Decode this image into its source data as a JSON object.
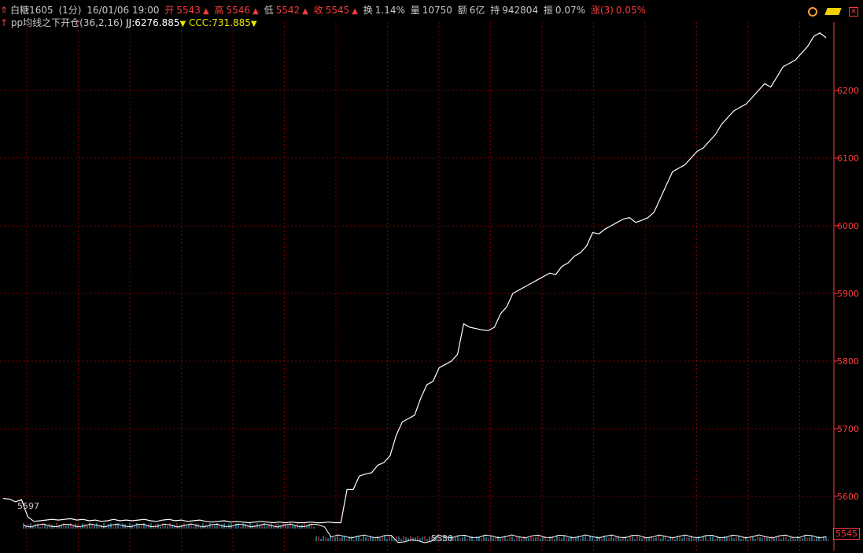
{
  "header": {
    "symbol": "白糖1605",
    "period": "(1分)",
    "datetime": "16/01/06 19:00",
    "open_label": "开",
    "open_value": "5543",
    "high_label": "高",
    "high_value": "5546",
    "low_label": "低",
    "low_value": "5542",
    "close_label": "收",
    "close_value": "5545",
    "turnover_label": "换",
    "turnover_value": "1.14%",
    "volume_label": "量",
    "volume_value": "10750",
    "amount_label": "额",
    "amount_value": "6亿",
    "oi_label": "持",
    "oi_value": "942804",
    "amplitude_label": "振",
    "amplitude_value": "0.07%",
    "change_label": "涨(3)",
    "change_value": "0.05%"
  },
  "indicator": {
    "name": "pp均线之下开仓(36,2,16)",
    "jj_label": "JJ:",
    "jj_value": "6276.885",
    "ccc_label": "CCC:",
    "ccc_value": "731.885"
  },
  "icons": {
    "left_marker": "up-arrow-icon",
    "clock": "clock-icon",
    "gold": "gold-bar-icon",
    "close": "close-icon"
  },
  "colors": {
    "background": "#000000",
    "grid": "#8b0000",
    "axis": "#ff3b3b",
    "line": "#ffffff",
    "up": "#ff3b3b",
    "down": "#00d800"
  },
  "chart_data": {
    "type": "line",
    "y_ticks": [
      5600,
      5700,
      5800,
      5900,
      6000,
      6100,
      6200
    ],
    "ylim": [
      5530,
      6285
    ],
    "annotations": [
      {
        "text": "5597",
        "value": 5597
      },
      {
        "text": "5530",
        "value": 5530
      }
    ],
    "last_price": "5545",
    "series": [
      {
        "values": [
          5597,
          5596,
          5592,
          5595,
          5570,
          5563,
          5564,
          5565,
          5566,
          5565,
          5566,
          5567,
          5565,
          5566,
          5564,
          5565,
          5563,
          5564,
          5566,
          5564,
          5565,
          5564,
          5565,
          5566,
          5564,
          5563,
          5565,
          5566,
          5564,
          5565,
          5563,
          5564,
          5565,
          5563,
          5562,
          5563,
          5564,
          5562,
          5563,
          5562,
          5561,
          5562,
          5563,
          5562,
          5561,
          5562,
          5561,
          5562,
          5561,
          5561,
          5562,
          5561,
          5561,
          5562,
          5561,
          5561,
          5610,
          5610,
          5630,
          5633,
          5635,
          5646,
          5650,
          5660,
          5690,
          5710,
          5715,
          5720,
          5745,
          5765,
          5770,
          5790,
          5795,
          5800,
          5810,
          5855,
          5850,
          5848,
          5846,
          5845,
          5850,
          5870,
          5880,
          5900,
          5905,
          5910,
          5915,
          5920,
          5925,
          5930,
          5928,
          5940,
          5945,
          5955,
          5960,
          5970,
          5990,
          5988,
          5995,
          6000,
          6005,
          6010,
          6012,
          6005,
          6008,
          6012,
          6020,
          6040,
          6060,
          6080,
          6085,
          6090,
          6100,
          6110,
          6115,
          6125,
          6135,
          6150,
          6160,
          6170,
          6175,
          6180,
          6190,
          6200,
          6210,
          6205,
          6220,
          6235,
          6240,
          6245,
          6255,
          6265,
          6280,
          6285,
          6278
        ]
      }
    ],
    "volume_bars": "mixed red/green ticks along the bottom band"
  }
}
